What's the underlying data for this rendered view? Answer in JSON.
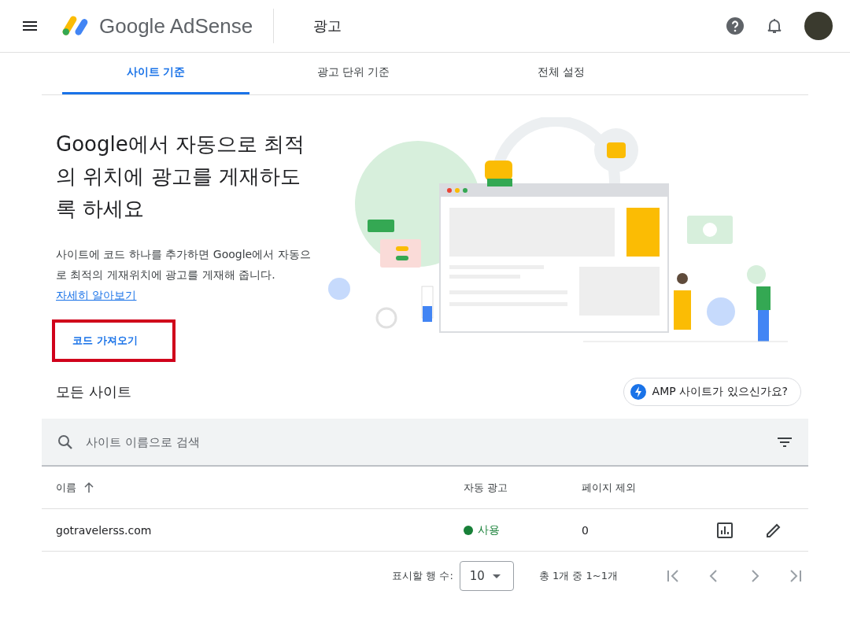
{
  "header": {
    "product": "Google AdSense",
    "section": "광고"
  },
  "tabs": [
    {
      "label": "사이트 기준",
      "selected": true
    },
    {
      "label": "광고 단위 기준",
      "selected": false
    },
    {
      "label": "전체 설정",
      "selected": false
    }
  ],
  "hero": {
    "title": "Google에서 자동으로 최적의 위치에 광고를 게재하도록 하세요",
    "description": "사이트에 코드 하나를 추가하면 Google에서 자동으로 최적의 게재위치에 광고를 게재해 줍니다.",
    "link": "자세히 알아보기",
    "button": "코드 가져오기",
    "button_highlighted": true
  },
  "sites": {
    "title": "모든 사이트",
    "amp_button": "AMP 사이트가 있으신가요?"
  },
  "search": {
    "placeholder": "사이트 이름으로 검색"
  },
  "table": {
    "columns": [
      {
        "label": "이름",
        "sorted": true
      },
      {
        "label": "자동 광고",
        "sorted": false
      },
      {
        "label": "페이지 제외",
        "sorted": false
      }
    ],
    "rows": [
      {
        "name": "gotravelerss.com",
        "auto_ads": {
          "label": "사용",
          "on": true
        },
        "excluded_pages": "0"
      }
    ]
  },
  "pagination": {
    "rows_label": "표시할 행 수:",
    "rows_value": "10",
    "range": "총 1개 중 1~1개"
  }
}
